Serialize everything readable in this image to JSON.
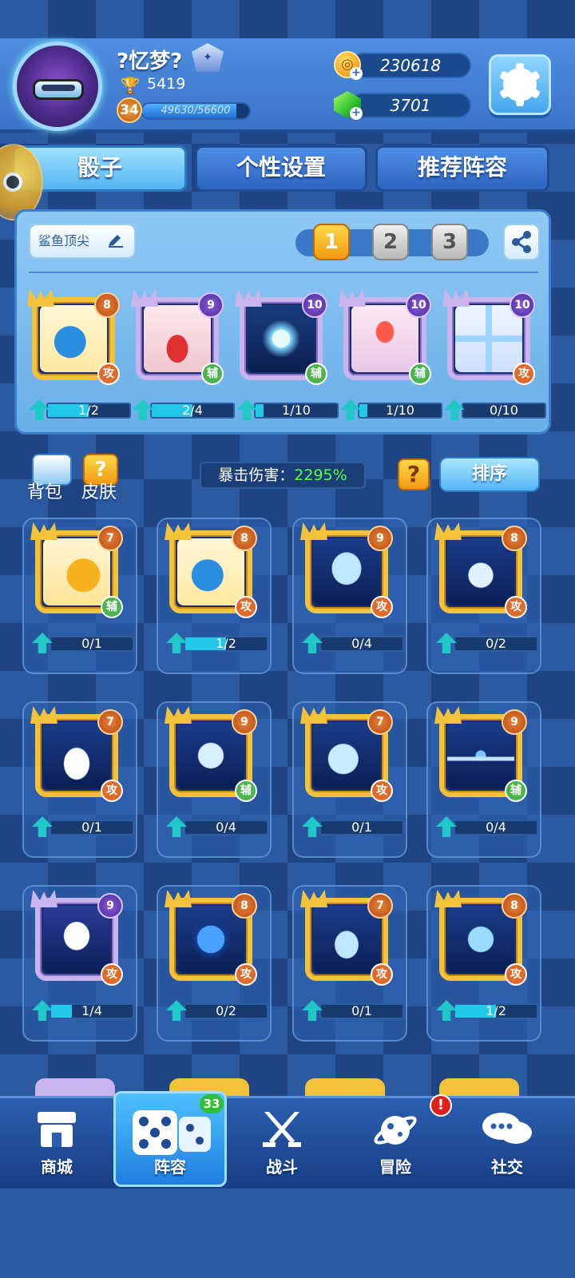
{
  "profile": {
    "username": "?忆梦?",
    "trophies": "5419",
    "level": "34",
    "xp_text": "49630/56600",
    "xp_progress": 0.877
  },
  "currency": {
    "gold": "230618",
    "gems": "3701"
  },
  "tabs": [
    {
      "label": "骰子",
      "active": true
    },
    {
      "label": "个性设置",
      "active": false
    },
    {
      "label": "推荐阵容",
      "active": false
    }
  ],
  "deck": {
    "name": "鲨鱼顶尖",
    "slots": [
      "1",
      "2",
      "3"
    ],
    "active_slot": 0,
    "cards": [
      {
        "level": "8",
        "role": "攻",
        "role_type": "atk",
        "progress": "1/2",
        "ratio": 0.5,
        "frame": "gold",
        "art": "shark"
      },
      {
        "level": "9",
        "role": "辅",
        "role_type": "sup",
        "progress": "2/4",
        "ratio": 0.5,
        "frame": "purple",
        "art": "hat"
      },
      {
        "level": "10",
        "role": "辅",
        "role_type": "sup",
        "progress": "1/10",
        "ratio": 0.1,
        "frame": "purple",
        "art": "dandelion"
      },
      {
        "level": "10",
        "role": "辅",
        "role_type": "sup",
        "progress": "1/10",
        "ratio": 0.1,
        "frame": "purple",
        "art": "flame-altar"
      },
      {
        "level": "10",
        "role": "攻",
        "role_type": "atk",
        "progress": "0/10",
        "ratio": 0.0,
        "frame": "purple",
        "art": "ice-cross"
      }
    ]
  },
  "collection": {
    "backpack_label": "背包",
    "skin_label": "皮肤",
    "crit_label": "暴击伤害：",
    "crit_value": "2295%",
    "help_icon": "?",
    "sort_label": "排序",
    "cards": [
      {
        "level": "7",
        "role": "辅",
        "role_type": "sup",
        "progress": "0/1",
        "ratio": 0.0,
        "frame": "gold",
        "art": "coins"
      },
      {
        "level": "8",
        "role": "攻",
        "role_type": "atk",
        "progress": "1/2",
        "ratio": 0.5,
        "frame": "gold",
        "art": "shark"
      },
      {
        "level": "9",
        "role": "攻",
        "role_type": "atk",
        "progress": "0/4",
        "ratio": 0.0,
        "frame": "gold",
        "art": "gemini"
      },
      {
        "level": "8",
        "role": "攻",
        "role_type": "atk",
        "progress": "0/2",
        "ratio": 0.0,
        "frame": "gold",
        "art": "taurus"
      },
      {
        "level": "7",
        "role": "攻",
        "role_type": "atk",
        "progress": "0/1",
        "ratio": 0.0,
        "frame": "gold",
        "art": "rabbit"
      },
      {
        "level": "9",
        "role": "辅",
        "role_type": "sup",
        "progress": "0/4",
        "ratio": 0.0,
        "frame": "gold",
        "art": "aries"
      },
      {
        "level": "7",
        "role": "攻",
        "role_type": "atk",
        "progress": "0/1",
        "ratio": 0.0,
        "frame": "gold",
        "art": "capricorn"
      },
      {
        "level": "9",
        "role": "辅",
        "role_type": "sup",
        "progress": "0/4",
        "ratio": 0.0,
        "frame": "gold",
        "art": "libra"
      },
      {
        "level": "9",
        "role": "攻",
        "role_type": "atk",
        "progress": "1/4",
        "ratio": 0.25,
        "frame": "purple",
        "art": "virgo"
      },
      {
        "level": "8",
        "role": "攻",
        "role_type": "atk",
        "progress": "0/2",
        "ratio": 0.0,
        "frame": "gold",
        "art": "leo"
      },
      {
        "level": "7",
        "role": "攻",
        "role_type": "atk",
        "progress": "0/1",
        "ratio": 0.0,
        "frame": "gold",
        "art": "cancer"
      },
      {
        "level": "8",
        "role": "攻",
        "role_type": "atk",
        "progress": "1/2",
        "ratio": 0.5,
        "frame": "gold",
        "art": "pisces"
      }
    ]
  },
  "nav": {
    "items": [
      {
        "label": "商城",
        "icon": "shop-icon"
      },
      {
        "label": "阵容",
        "icon": "dice-icon"
      },
      {
        "label": "战斗",
        "icon": "swords-icon"
      },
      {
        "label": "冒险",
        "icon": "planet-icon"
      },
      {
        "label": "社交",
        "icon": "chat-icon"
      }
    ],
    "active": 1,
    "lineup_badge": "33",
    "adventure_alert": "!"
  },
  "colors": {
    "background": "#2b5aa0",
    "gold_frame": "#f2c23a",
    "purple_frame": "#c9b4ee",
    "attack_role": "#e06a2a",
    "support_role": "#4cb44c",
    "crit_value": "#5cff3a"
  }
}
